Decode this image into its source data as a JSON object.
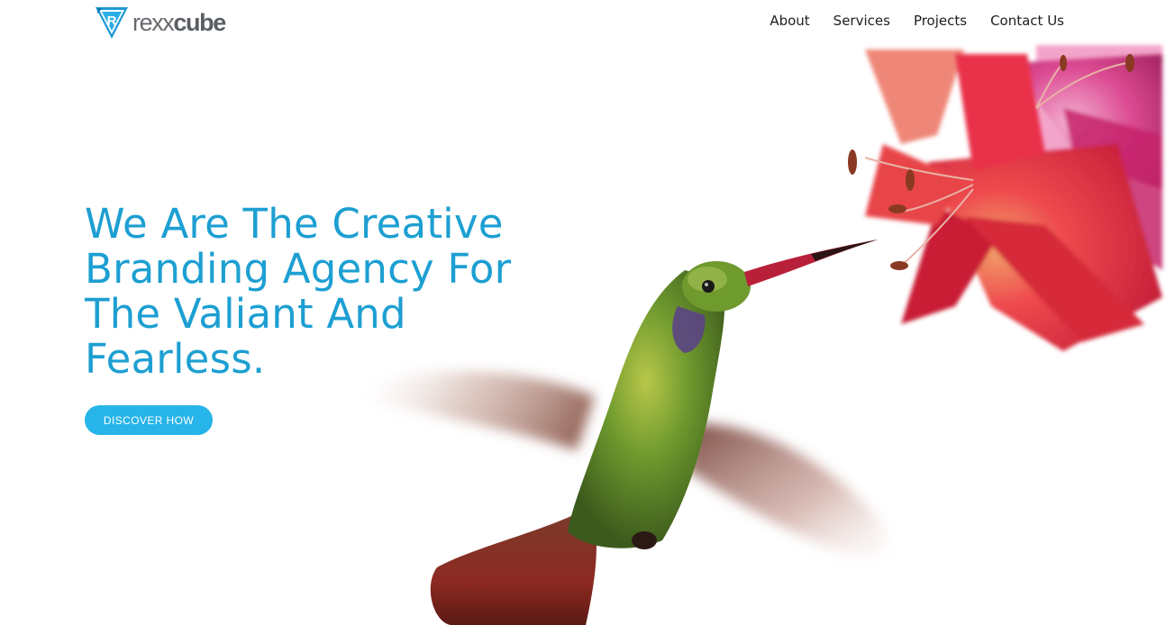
{
  "brand": {
    "name_light": "rexx",
    "name_bold": "cube",
    "logo_icon": "rexxcube-r-shield-icon",
    "accent_color": "#1d9fd2"
  },
  "nav": {
    "items": [
      {
        "label": "About"
      },
      {
        "label": "Services"
      },
      {
        "label": "Projects"
      },
      {
        "label": "Contact Us"
      }
    ]
  },
  "hero": {
    "headline": "We Are The Creative Branding Agency For The Valiant And Fearless.",
    "cta_label": "DISCOVER HOW",
    "cta_color": "#27b4e8",
    "image": "hummingbird-and-lily-flowers"
  }
}
